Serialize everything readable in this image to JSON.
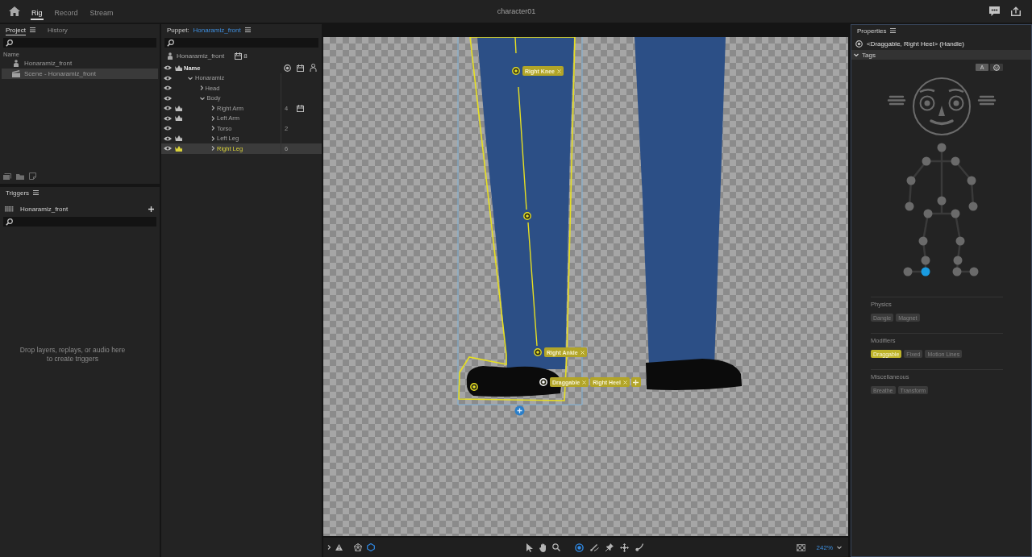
{
  "top_bar": {
    "tabs": [
      {
        "label": "Rig",
        "selected": true
      },
      {
        "label": "Record",
        "selected": false
      },
      {
        "label": "Stream",
        "selected": false
      }
    ],
    "title": "character01"
  },
  "project_panel": {
    "tabs": [
      {
        "label": "Project",
        "selected": true
      },
      {
        "label": "History",
        "selected": false
      }
    ],
    "column_header": "Name",
    "items": [
      {
        "kind": "puppet",
        "label": "Honaramiz_front",
        "selected": false
      },
      {
        "kind": "scene",
        "label": "Scene - Honaramiz_front",
        "selected": true
      }
    ]
  },
  "triggers_panel": {
    "title": "Triggers",
    "puppet": "Honaramiz_front",
    "empty_message": "Drop layers, replays, or audio here to create triggers"
  },
  "puppet_panel": {
    "label": "Puppet:",
    "puppet_name": "Honaramiz_front",
    "root": {
      "name": "Honaramiz_front",
      "count": "8"
    },
    "column_header": "Name",
    "layers": [
      {
        "name": "Honaramiz",
        "visible": true,
        "crown": false,
        "selected": false,
        "expanded": true,
        "marker": false,
        "children": [
          {
            "name": "Head",
            "visible": true,
            "crown": false,
            "selected": false,
            "expanded": false,
            "marker": false
          },
          {
            "name": "Body",
            "visible": true,
            "crown": false,
            "selected": false,
            "expanded": true,
            "marker": false,
            "children": [
              {
                "name": "Right Arm",
                "visible": true,
                "crown": true,
                "selected": false,
                "expanded": false,
                "count": "4",
                "marker": true
              },
              {
                "name": "Left Arm",
                "visible": true,
                "crown": true,
                "selected": false,
                "expanded": false,
                "marker": false
              },
              {
                "name": "Torso",
                "visible": true,
                "crown": false,
                "selected": false,
                "expanded": false,
                "count": "2",
                "marker": false
              },
              {
                "name": "Left Leg",
                "visible": true,
                "crown": true,
                "selected": false,
                "expanded": false,
                "marker": false
              },
              {
                "name": "Right Leg",
                "visible": true,
                "crown": true,
                "selected": true,
                "expanded": false,
                "count": "6",
                "marker": false
              }
            ]
          }
        ]
      }
    ]
  },
  "canvas": {
    "handles": [
      {
        "tags": [
          "Right Knee"
        ],
        "selected": false
      },
      {
        "selected": false
      },
      {
        "tags": [
          "Right Ankle"
        ],
        "selected": false
      },
      {
        "tags": [
          "Draggable",
          "Right Heel"
        ],
        "selected": true
      },
      {
        "selected": false
      }
    ],
    "view_toggles": [
      {
        "kind": "mesh",
        "on": false
      },
      {
        "kind": "outline",
        "on": true
      }
    ],
    "tools": [
      {
        "kind": "select",
        "selected": false
      },
      {
        "kind": "hand",
        "selected": false
      },
      {
        "kind": "zoom",
        "selected": false
      },
      {
        "kind": "handle",
        "selected": true
      },
      {
        "kind": "stick",
        "selected": false
      },
      {
        "kind": "pin",
        "selected": false
      },
      {
        "kind": "dragger",
        "selected": false
      },
      {
        "kind": "draw",
        "selected": false
      }
    ],
    "zoom": "242%"
  },
  "properties": {
    "title": "Properties",
    "selection": "<Draggable, Right Heel> (Handle)",
    "section": {
      "label": "Tags",
      "expanded": true
    },
    "view_buttons": [
      {
        "kind": "text",
        "label": "A",
        "selected": true
      },
      {
        "kind": "face",
        "selected": false
      }
    ],
    "figure_dots": [
      {
        "selected": false
      },
      {
        "selected": false
      },
      {
        "selected": false
      },
      {
        "selected": false
      },
      {
        "selected": false
      },
      {
        "selected": false
      },
      {
        "selected": false
      },
      {
        "selected": false
      },
      {
        "selected": false
      },
      {
        "selected": false
      },
      {
        "selected": false
      },
      {
        "selected": false
      },
      {
        "selected": false
      },
      {
        "selected": false
      },
      {
        "selected": false
      },
      {
        "selected": true
      },
      {
        "selected": false
      },
      {
        "selected": false
      }
    ],
    "groups": [
      {
        "title": "Physics",
        "tags": [
          {
            "label": "Dangle",
            "selected": false
          },
          {
            "label": "Magnet",
            "selected": false
          }
        ]
      },
      {
        "title": "Modifiers",
        "tags": [
          {
            "label": "Draggable",
            "selected": true
          },
          {
            "label": "Fixed",
            "selected": false
          },
          {
            "label": "Motion Lines",
            "selected": false
          }
        ]
      },
      {
        "title": "Miscellaneous",
        "tags": [
          {
            "label": "Breathe",
            "selected": false
          },
          {
            "label": "Transform",
            "selected": false
          }
        ]
      }
    ]
  }
}
